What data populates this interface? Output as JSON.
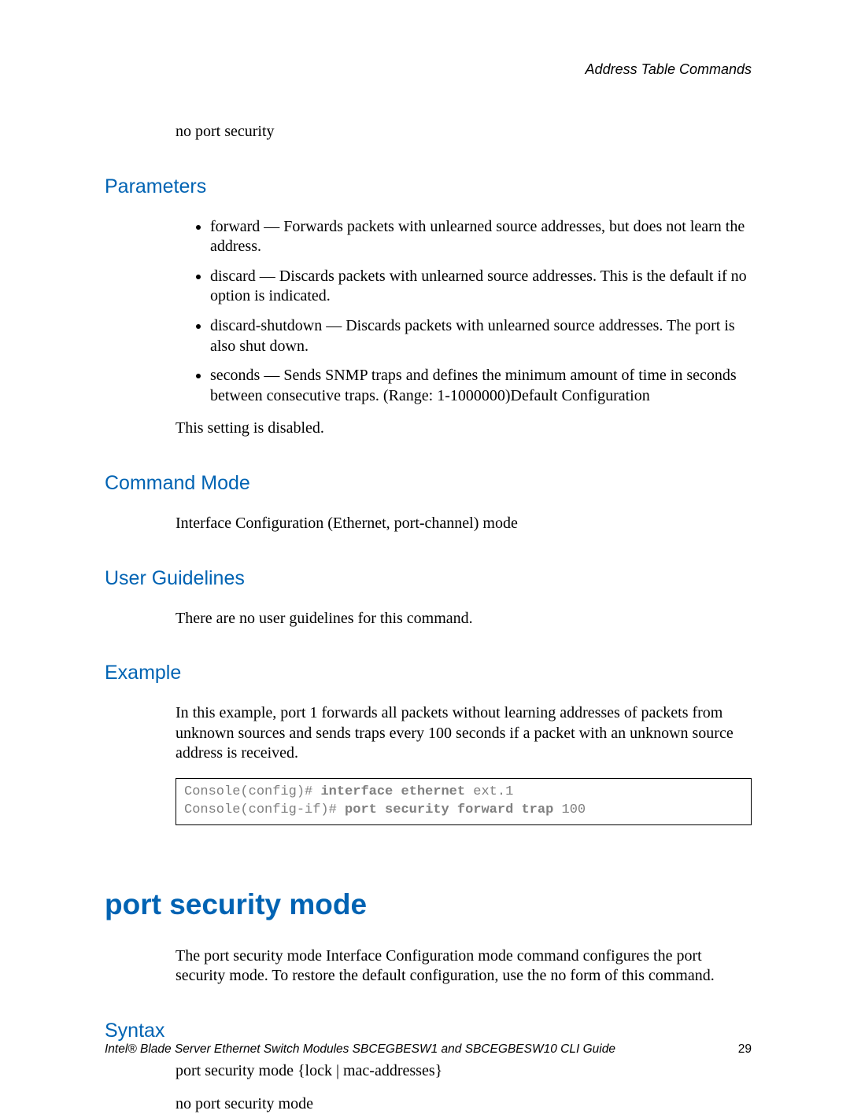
{
  "header": {
    "running": "Address Table Commands"
  },
  "intro": {
    "no_ps": "no port security"
  },
  "parameters": {
    "heading": "Parameters",
    "items": [
      "forward — Forwards packets with unlearned source addresses, but does not learn the address.",
      "discard — Discards packets with unlearned source addresses. This is the default if no option is indicated.",
      "discard-shutdown — Discards packets with unlearned source addresses. The port is also shut down.",
      "seconds — Sends SNMP traps and defines the minimum amount of time in seconds between consecutive traps. (Range: 1-1000000)Default Configuration"
    ],
    "after": "This setting is disabled."
  },
  "command_mode": {
    "heading": "Command Mode",
    "body": "Interface Configuration (Ethernet, port-channel) mode"
  },
  "user_guidelines": {
    "heading": "User Guidelines",
    "body": "There are no user guidelines for this command."
  },
  "example": {
    "heading": "Example",
    "body": "In this example, port 1 forwards all packets without learning addresses of packets from unknown sources and sends traps every 100 seconds if a packet with an unknown source address is received.",
    "code": {
      "line1_prefix": "Console(config)# ",
      "line1_bold": "interface ethernet ",
      "line1_suffix": "ext.1",
      "line2_prefix": "Console(config-if)# ",
      "line2_bold": "port security forward trap ",
      "line2_suffix": "100"
    }
  },
  "port_security_mode": {
    "heading": "port security mode",
    "body": "The port security mode Interface Configuration mode command configures the port security mode. To restore the default configuration, use the no form of this command."
  },
  "syntax": {
    "heading": "Syntax",
    "line1": "port security mode {lock | mac-addresses}",
    "line2": "no port security mode"
  },
  "footer": {
    "text": "Intel® Blade Server Ethernet Switch Modules SBCEGBESW1 and SBCEGBESW10 CLI Guide",
    "page": "29"
  }
}
